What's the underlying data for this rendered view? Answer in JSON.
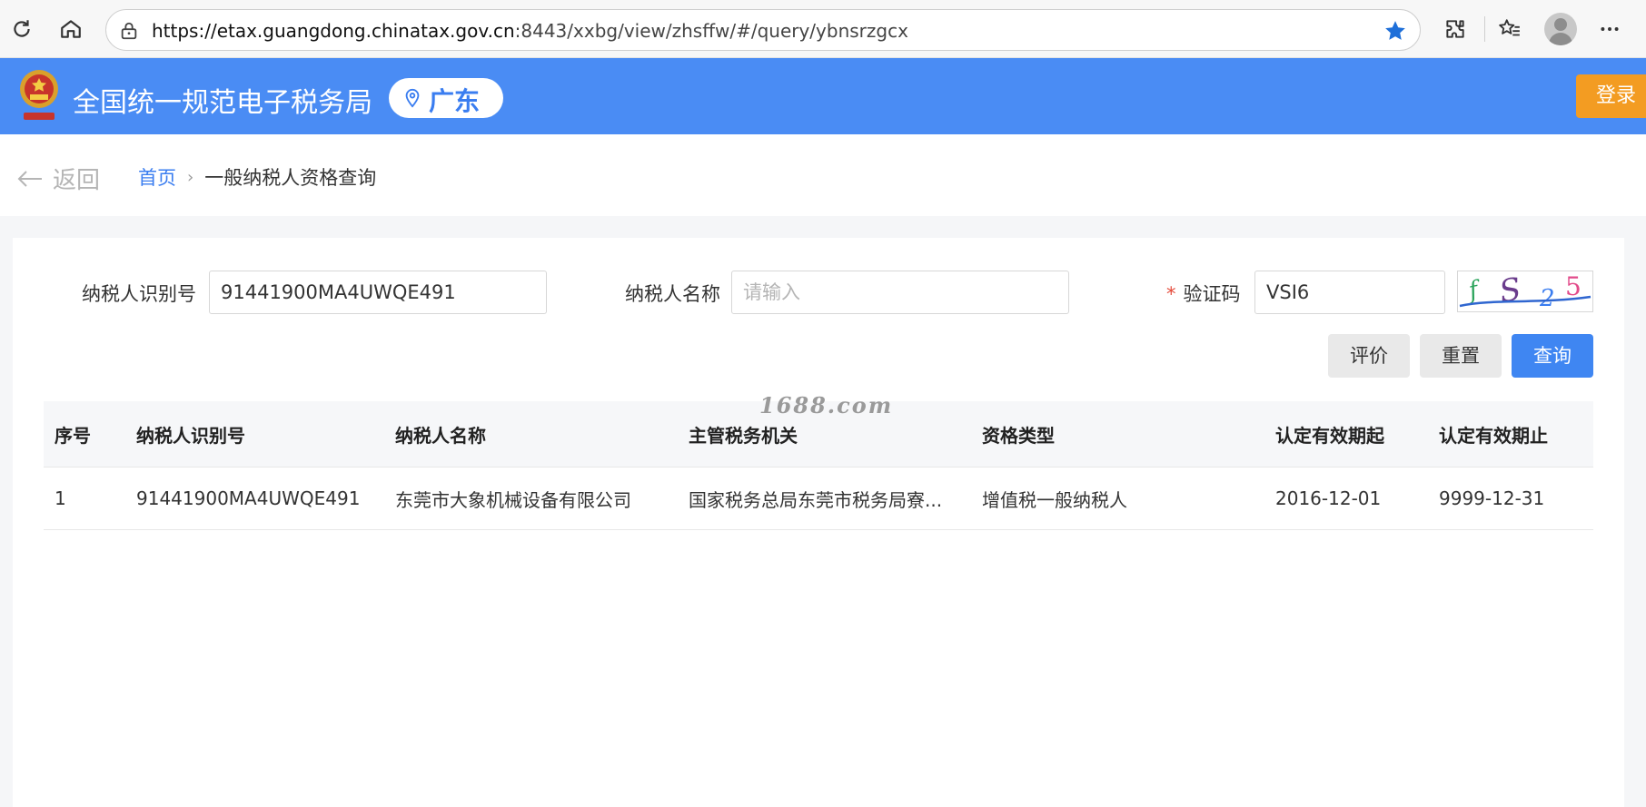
{
  "browser": {
    "url_host": "https://etax.guangdong.chinatax.gov.cn",
    "url_path": ":8443/xxbg/view/zhsffw/#/query/ybnsrzgcx"
  },
  "header": {
    "site_title": "全国统一规范电子税务局",
    "region": "广东",
    "login_label": "登录"
  },
  "breadcrumb": {
    "back_label": "返回",
    "home": "首页",
    "current": "一般纳税人资格查询"
  },
  "form": {
    "taxpayer_id_label": "纳税人识别号",
    "taxpayer_id_value": "91441900MA4UWQE491",
    "taxpayer_name_label": "纳税人名称",
    "taxpayer_name_placeholder": "请输入",
    "captcha_required": "*",
    "captcha_label": "验证码",
    "captcha_value": "VSI6",
    "captcha_chars": "fS25",
    "btn_evaluate": "评价",
    "btn_reset": "重置",
    "btn_query": "查询"
  },
  "table": {
    "headers": [
      "序号",
      "纳税人识别号",
      "纳税人名称",
      "主管税务机关",
      "资格类型",
      "认定有效期起",
      "认定有效期止"
    ],
    "rows": [
      [
        "1",
        "91441900MA4UWQE491",
        "东莞市大象机械设备有限公司",
        "国家税务总局东莞市税务局寮...",
        "增值税一般纳税人",
        "2016-12-01",
        "9999-12-31"
      ]
    ]
  },
  "watermark": "1688.com",
  "colors": {
    "primary": "#3f86f2",
    "header_bg": "#4a8cf4",
    "login_bg": "#f39c22"
  }
}
